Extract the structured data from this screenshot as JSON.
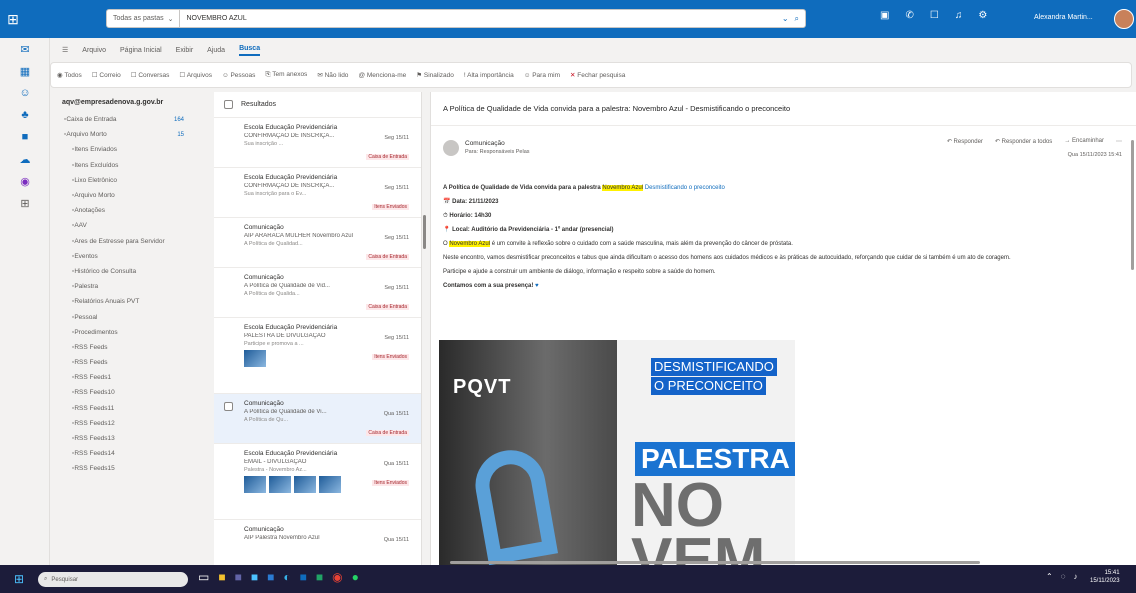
{
  "search": {
    "scope": "Todas as pastas",
    "query": "NOVEMBRO AZUL"
  },
  "user": {
    "name": "Alexandra Martin..."
  },
  "menu": [
    "Arquivo",
    "Página Inicial",
    "Exibir",
    "Ajuda",
    "Busca"
  ],
  "ribbon": [
    "Todos",
    "Correio",
    "Conversas",
    "Arquivos",
    "Pessoas",
    "Tem anexos",
    "Não lido",
    "Menciona-me",
    "Sinalizado",
    "Alta importância",
    "Para mim",
    "Fechar pesquisa"
  ],
  "folders": {
    "header": "aqv@empresadenova.g.gov.br",
    "items": [
      {
        "label": "Caixa de Entrada",
        "count": "164"
      },
      {
        "label": "Arquivo Morto",
        "count": "15"
      },
      {
        "label": "Itens Enviados",
        "count": ""
      },
      {
        "label": "Itens Excluídos",
        "count": ""
      },
      {
        "label": "Lixo Eletrônico",
        "count": ""
      },
      {
        "label": "Arquivo Morto",
        "count": ""
      },
      {
        "label": "Anotações",
        "count": ""
      },
      {
        "label": "AAV",
        "count": ""
      },
      {
        "label": "Ares de Estresse para Servidor",
        "count": ""
      },
      {
        "label": "Eventos",
        "count": ""
      },
      {
        "label": "Histórico de Consulta",
        "count": ""
      },
      {
        "label": "Palestra",
        "count": ""
      },
      {
        "label": "Relatórios Anuais PVT",
        "count": ""
      },
      {
        "label": "Pessoal",
        "count": ""
      },
      {
        "label": "Procedimentos",
        "count": ""
      },
      {
        "label": "RSS Feeds",
        "count": ""
      },
      {
        "label": "RSS Feeds",
        "count": ""
      },
      {
        "label": "RSS Feeds1",
        "count": ""
      },
      {
        "label": "RSS Feeds10",
        "count": ""
      },
      {
        "label": "RSS Feeds11",
        "count": ""
      },
      {
        "label": "RSS Feeds12",
        "count": ""
      },
      {
        "label": "RSS Feeds13",
        "count": ""
      },
      {
        "label": "RSS Feeds14",
        "count": ""
      },
      {
        "label": "RSS Feeds15",
        "count": ""
      }
    ]
  },
  "list": {
    "header": "Resultados",
    "items": [
      {
        "sender": "Escola Educação Previdenciária",
        "subject": "CONFIRMAÇÃO DE INSCRIÇÃ...",
        "preview": "Sua inscrição ...",
        "date": "Seg 15/11",
        "cat": "Caixa de Entrada"
      },
      {
        "sender": "Escola Educação Previdenciária",
        "subject": "CONFIRMAÇÃO DE INSCRIÇÃ...",
        "preview": "Sua inscrição para o Ev...",
        "date": "Seg 15/11",
        "cat": "Itens Enviados"
      },
      {
        "sender": "Comunicação",
        "subject": "AIP ARARACA MULHER Novembro Azul",
        "preview": "A Política de Qualidad...",
        "date": "Seg 15/11",
        "cat": "Caixa de Entrada"
      },
      {
        "sender": "Comunicação",
        "subject": "A Política de Qualidade de Vid...",
        "preview": "A Política de Qualida...",
        "date": "Seg 15/11",
        "cat": "Caixa de Entrada"
      },
      {
        "sender": "Escola Educação Previdenciária",
        "subject": "PALESTRA DE DIVULGAÇÃO",
        "preview": "Participe e promova a ...",
        "date": "Seg 15/11",
        "cat": "Itens Enviados"
      },
      {
        "sender": "Comunicação",
        "subject": "A Política de Qualidade de Vi...",
        "preview": "A Política de Qu...",
        "date": "Qua 15/11",
        "cat": "Caixa de Entrada"
      },
      {
        "sender": "Escola Educação Previdenciária",
        "subject": "EMAIL - DIVULGAÇÃO",
        "preview": "Palestra - Novembro Az...",
        "date": "Qua 15/11",
        "cat": "Itens Enviados"
      },
      {
        "sender": "Comunicação",
        "subject": "AIP Palestra Novembro Azul",
        "preview": "",
        "date": "Qua 15/11",
        "cat": ""
      }
    ]
  },
  "reading": {
    "subject": "A Política de Qualidade de Vida convida para a palestra: Novembro Azul - Desmistificando o preconceito",
    "sender": "Comunicação",
    "to": "Para: Responsáveis Pelas",
    "actions": [
      "Responder",
      "Responder a todos",
      "Encaminhar"
    ],
    "date": "Qua 15/11/2023 15:41",
    "intro_a": "A Política de Qualidade de Vida convida para a palestra",
    "intro_hl": "Novembro Azul",
    "intro_b": "Desmistificando o preconceito",
    "data_line": "Data: 21/11/2023",
    "hora_line": "Horário: 14h30",
    "local_line": "Local: Auditório da Previdenciária - 1º andar (presencial)",
    "p1_hl": "Novembro Azul",
    "p1": "é um convite à reflexão sobre o cuidado com a saúde masculina, mais além da prevenção do câncer de próstata.",
    "p2": "Neste encontro, vamos desmistificar preconceitos e tabus que ainda dificultam o acesso dos homens aos cuidados médicos e às práticas de autocuidado, reforçando que cuidar de si também é um ato de coragem.",
    "p3": "Participe e ajude a construir um ambiente de diálogo, informação e respeito sobre a saúde do homem.",
    "p4": "Contamos com a sua presença!",
    "banner": {
      "logo": "PQVT",
      "t1": "DESMISTIFICANDO",
      "t2": "O PRECONCEITO",
      "t3": "PALESTRA",
      "t4": "NO",
      "t5": "VEM"
    }
  },
  "taskbar": {
    "search": "Pesquisar",
    "time": "15:41",
    "date": "15/11/2023"
  },
  "colors": {
    "brand": "#0f6cbd",
    "highlight": "#fff100",
    "banner_blue": "#1463c9"
  }
}
